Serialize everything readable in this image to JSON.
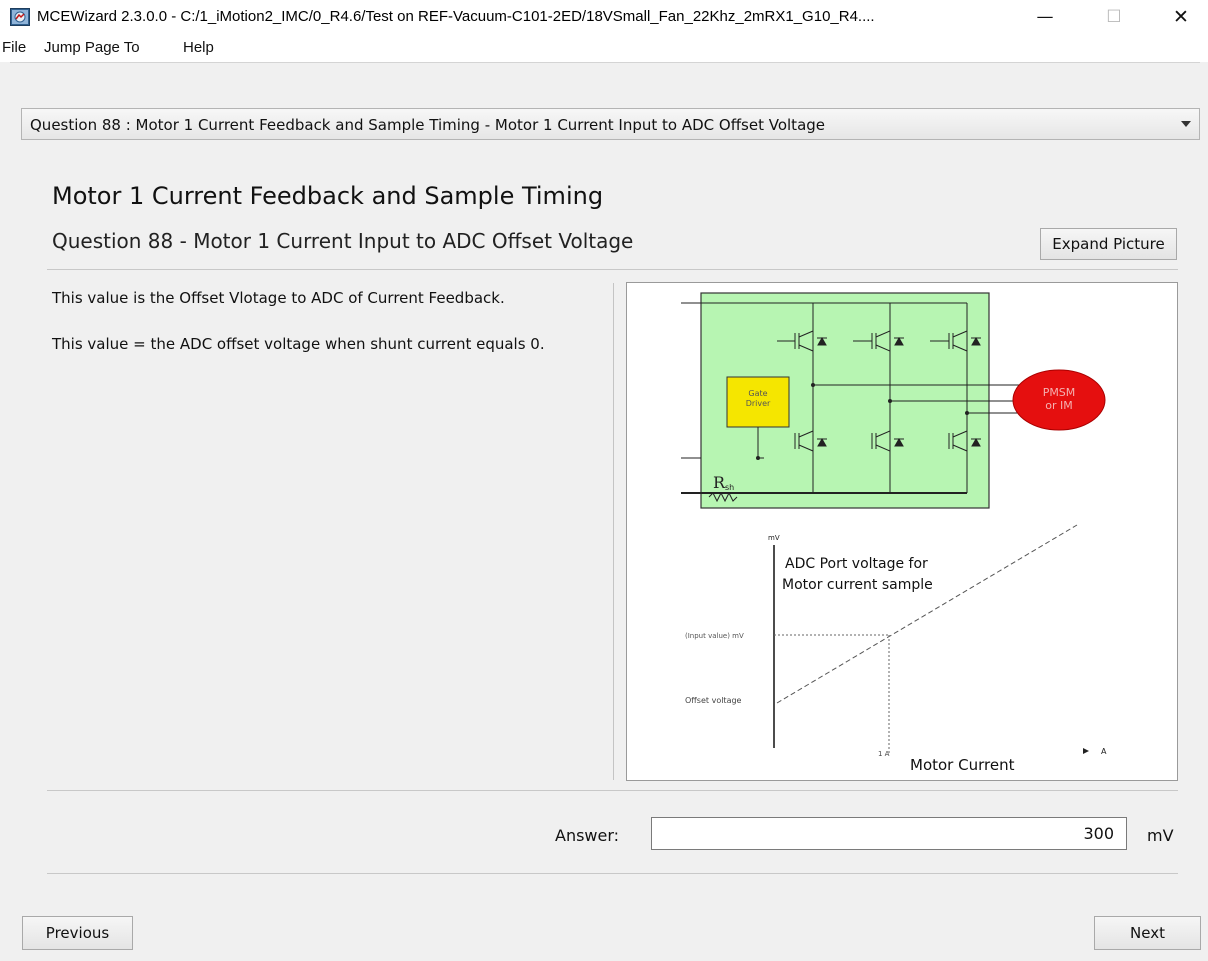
{
  "window": {
    "title": "MCEWizard 2.3.0.0  - C:/1_iMotion2_IMC/0_R4.6/Test on REF-Vacuum-C101-2ED/18VSmall_Fan_22Khz_2mRX1_G10_R4....",
    "icon": "motor-wizard-icon",
    "minimize_glyph": "—",
    "maximize_glyph": "☐",
    "close_glyph": "✕"
  },
  "menu": {
    "items": [
      "File",
      "Jump Page To",
      "Help"
    ]
  },
  "question_selector": {
    "selected": "Question  88 : Motor 1 Current Feedback and Sample Timing - Motor 1 Current Input to ADC Offset Voltage"
  },
  "section_title": "Motor 1 Current Feedback and Sample Timing",
  "question_title": "Question 88 - Motor 1 Current Input to ADC Offset Voltage",
  "expand_button_label": "Expand Picture",
  "description": {
    "line1": "This value is the Offset Vlotage to ADC of Current Feedback.",
    "line2": "This value = the ADC offset voltage when shunt current equals 0."
  },
  "figure": {
    "gate_driver_label_1": "Gate",
    "gate_driver_label_2": "Driver",
    "motor_label_1": "PMSM",
    "motor_label_2": "or IM",
    "shunt_label": "R",
    "shunt_sub": "sh",
    "graph_y_unit": "mV",
    "graph_title_1": "ADC Port voltage for",
    "graph_title_2": "Motor current sample",
    "input_value_label": "(Input value) mV",
    "offset_label": "Offset voltage",
    "x_tick_label": "1 A",
    "x_axis_label": "Motor Current",
    "x_unit": "A",
    "colors": {
      "board": "#b7f5b2",
      "gate_driver": "#f5e600",
      "motor": "#e50f0f"
    }
  },
  "answer": {
    "label": "Answer:",
    "value": "300",
    "unit": "mV"
  },
  "nav": {
    "previous_label": "Previous",
    "next_label": "Next"
  }
}
